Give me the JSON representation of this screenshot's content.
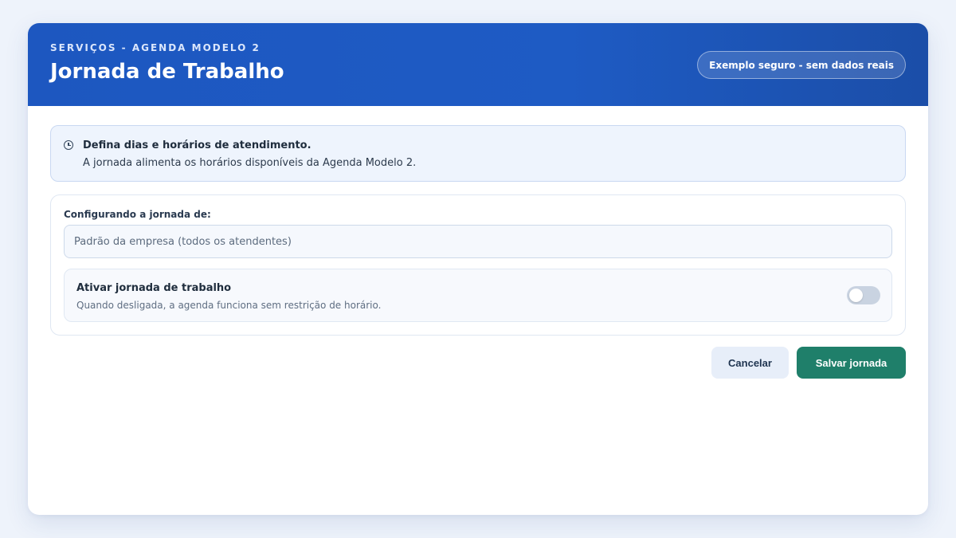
{
  "header": {
    "eyebrow": "SERVIÇOS - AGENDA MODELO 2",
    "title": "Jornada de Trabalho",
    "badge": "Exemplo seguro - sem dados reais"
  },
  "notice": {
    "icon": "clock-icon",
    "title": "Defina dias e horários de atendimento.",
    "description": "A jornada alimenta os horários disponíveis da Agenda Modelo 2."
  },
  "config": {
    "label": "Configurando a jornada de:",
    "select_value": "Padrão da empresa (todos os atendentes)"
  },
  "toggle": {
    "title": "Ativar jornada de trabalho",
    "description": "Quando desligada, a agenda funciona sem restrição de horário.",
    "enabled": false
  },
  "actions": {
    "cancel_label": "Cancelar",
    "save_label": "Salvar jornada"
  },
  "colors": {
    "header": "#1e5bc4",
    "save_button": "#1f7f6a",
    "cancel_button": "#e7eef9",
    "background": "#eef3fb"
  }
}
